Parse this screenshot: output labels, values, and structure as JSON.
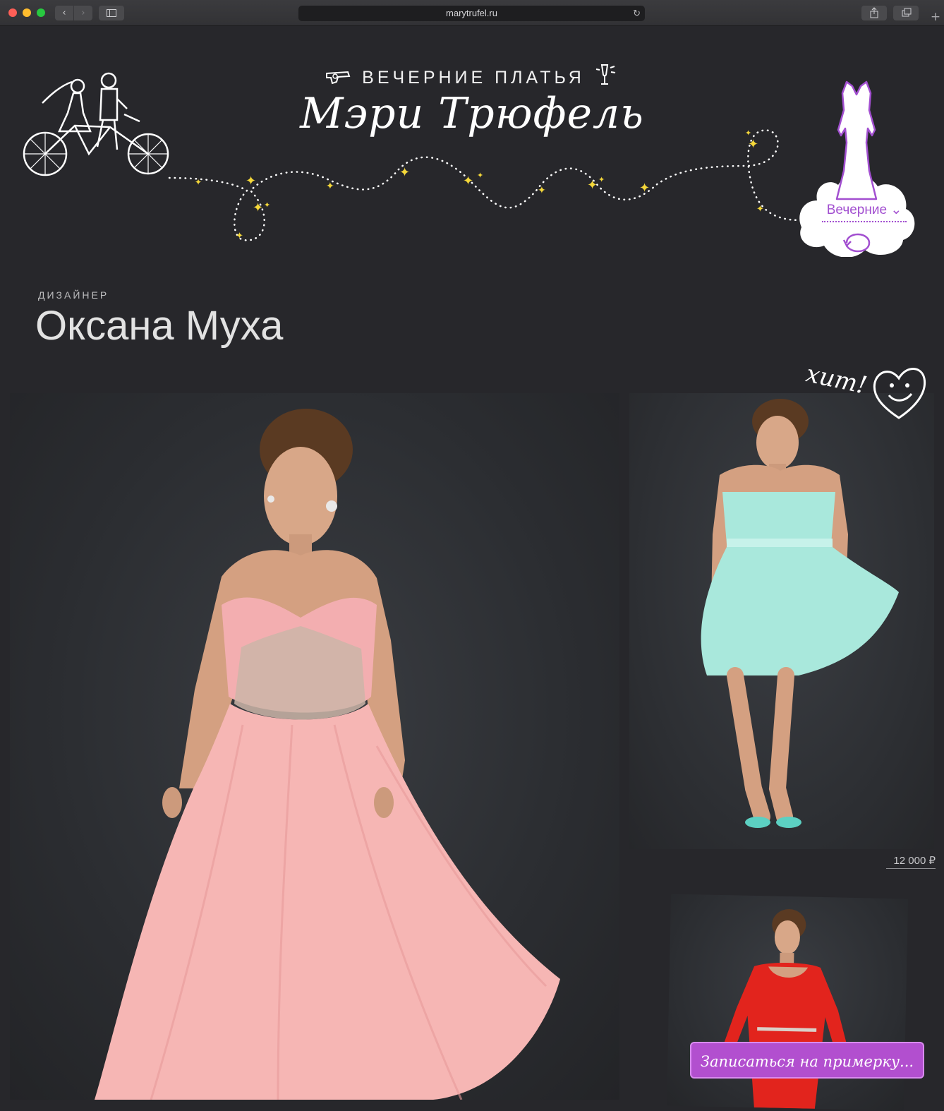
{
  "browser": {
    "url": "marytrufel.ru",
    "back_label": "‹",
    "forward_label": "›",
    "reload_icon": "↻",
    "new_tab_label": "+"
  },
  "header": {
    "subtitle": "ВЕЧЕРНИЕ ПЛАТЬЯ",
    "logo_text": "Мэри Трюфель"
  },
  "category": {
    "selected": "Вечерние ⌄"
  },
  "designer": {
    "label": "ДИЗАЙНЕР",
    "name": "Оксана Муха"
  },
  "products": {
    "hit_label": "хит!",
    "side_price": "12 000 ₽"
  },
  "cta": {
    "label": "Записаться на примерку..."
  },
  "colors": {
    "background": "#27272b",
    "accent_purple": "#b24fcf",
    "sparkle_yellow": "#f5d83a",
    "dress_pink": "#f6b6b4",
    "dress_mint": "#a9e8dc",
    "dress_red": "#e2241d"
  }
}
